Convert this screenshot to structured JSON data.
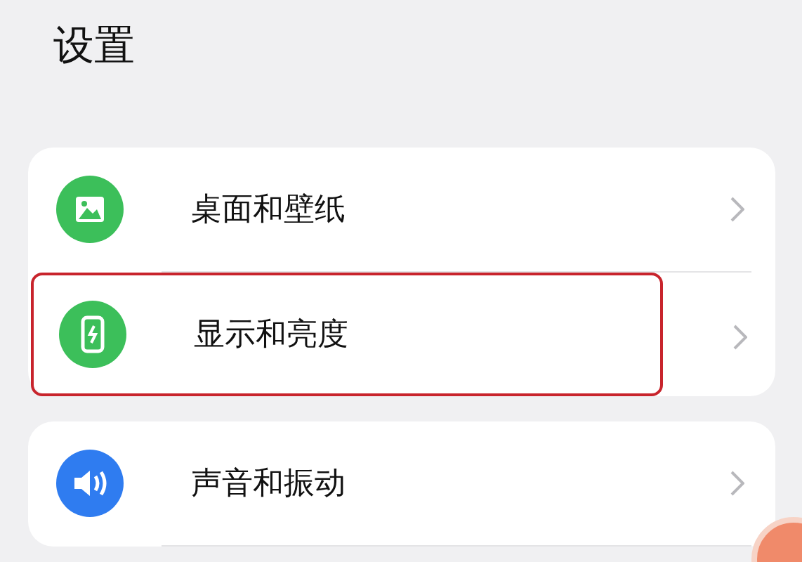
{
  "title": "设置",
  "groups": [
    {
      "items": [
        {
          "label": "桌面和壁纸",
          "kind": "picture",
          "color": "#3cbf5a",
          "highlighted": false
        },
        {
          "label": "显示和亮度",
          "kind": "phone",
          "color": "#3cbf5a",
          "highlighted": true
        }
      ]
    },
    {
      "items": [
        {
          "label": "声音和振动",
          "kind": "speaker",
          "color": "#2f7cf0",
          "highlighted": false
        }
      ]
    }
  ]
}
